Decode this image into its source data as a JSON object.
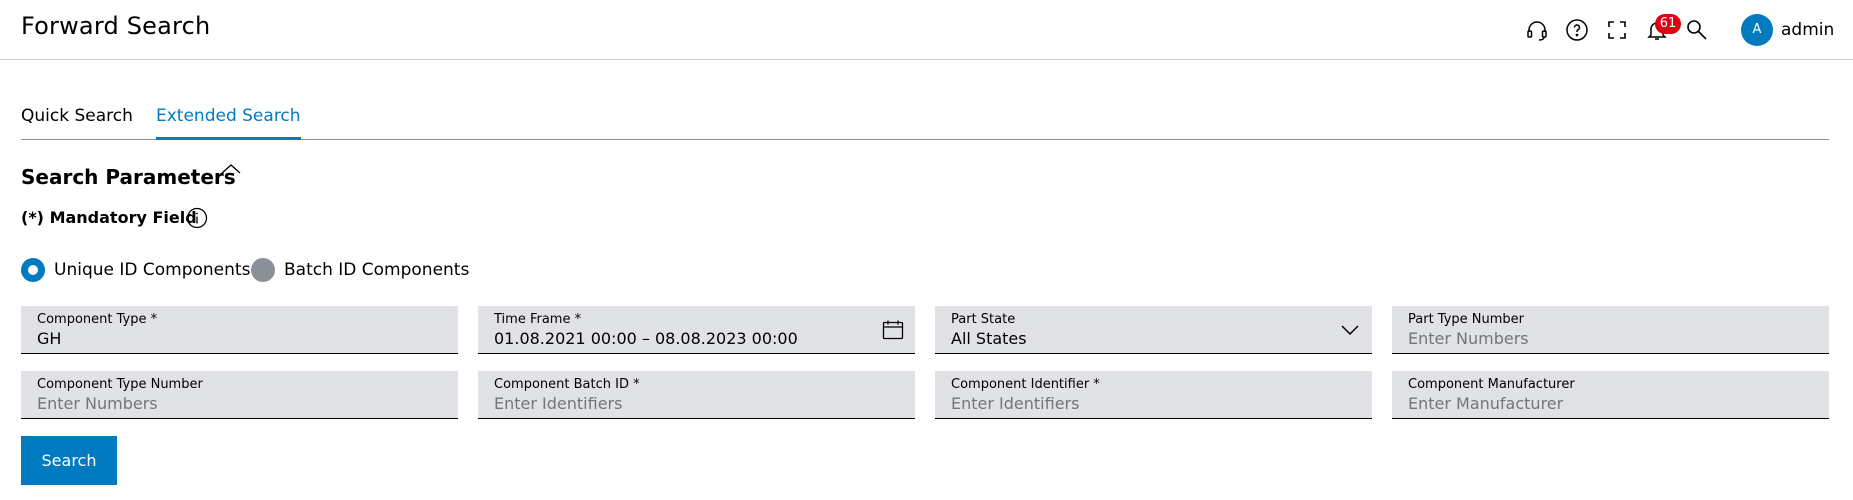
{
  "header": {
    "title": "Forward Search",
    "icons": [
      "headset-icon",
      "help-icon",
      "fullscreen-icon",
      "bell-icon",
      "search-icon"
    ],
    "notification_count": "61",
    "avatar_initial": "A",
    "username": "admin"
  },
  "tabs": [
    {
      "label": "Quick Search",
      "active": false
    },
    {
      "label": "Extended Search",
      "active": true
    }
  ],
  "section": {
    "title": "Search Parameters",
    "mandatory_note": "(*) Mandatory Field"
  },
  "id_type": {
    "options": [
      {
        "label": "Unique ID Components",
        "selected": true
      },
      {
        "label": "Batch ID Components",
        "selected": false
      }
    ]
  },
  "fields": {
    "component_type": {
      "label": "Component Type *",
      "value": "GH"
    },
    "time_frame": {
      "label": "Time Frame *",
      "value": "01.08.2021 00:00 – 08.08.2023 00:00"
    },
    "part_state": {
      "label": "Part State",
      "value": "All States"
    },
    "part_type_number": {
      "label": "Part Type Number",
      "placeholder": "Enter Numbers"
    },
    "component_type_number": {
      "label": "Component Type Number",
      "placeholder": "Enter Numbers"
    },
    "component_batch_id": {
      "label": "Component Batch ID *",
      "placeholder": "Enter Identifiers"
    },
    "component_identifier": {
      "label": "Component Identifier *",
      "placeholder": "Enter Identifiers"
    },
    "component_manufacturer": {
      "label": "Component Manufacturer",
      "placeholder": "Enter Manufacturer"
    }
  },
  "actions": {
    "search_label": "Search"
  },
  "colors": {
    "accent": "#007bc0",
    "field_bg": "#e0e2e5",
    "badge": "#e00015"
  }
}
